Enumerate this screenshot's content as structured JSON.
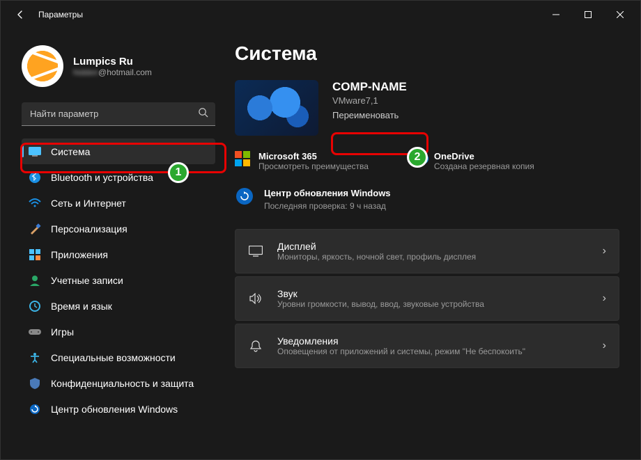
{
  "window": {
    "title": "Параметры"
  },
  "profile": {
    "name": "Lumpics Ru",
    "email_hidden": "hidden",
    "email_suffix": "@hotmail.com"
  },
  "search": {
    "placeholder": "Найти параметр"
  },
  "sidebar": {
    "items": [
      {
        "label": "Система"
      },
      {
        "label": "Bluetooth и устройства"
      },
      {
        "label": "Сеть и Интернет"
      },
      {
        "label": "Персонализация"
      },
      {
        "label": "Приложения"
      },
      {
        "label": "Учетные записи"
      },
      {
        "label": "Время и язык"
      },
      {
        "label": "Игры"
      },
      {
        "label": "Специальные возможности"
      },
      {
        "label": "Конфиденциальность и защита"
      },
      {
        "label": "Центр обновления Windows"
      }
    ]
  },
  "annotations": {
    "badge1": "1",
    "badge2": "2"
  },
  "page": {
    "title": "Система",
    "device": {
      "name": "COMP-NAME",
      "model": "VMware7,1",
      "rename": "Переименовать"
    },
    "promos": {
      "ms365": {
        "title": "Microsoft 365",
        "sub": "Просмотреть преимущества"
      },
      "onedrive": {
        "title": "OneDrive",
        "sub": "Создана резервная копия"
      }
    },
    "update": {
      "title": "Центр обновления Windows",
      "sub": "Последняя проверка: 9 ч назад"
    },
    "cards": [
      {
        "title": "Дисплей",
        "sub": "Мониторы, яркость, ночной свет, профиль дисплея"
      },
      {
        "title": "Звук",
        "sub": "Уровни громкости, вывод, ввод, звуковые устройства"
      },
      {
        "title": "Уведомления",
        "sub": "Оповещения от приложений и системы, режим \"Не беспокоить\""
      }
    ]
  }
}
